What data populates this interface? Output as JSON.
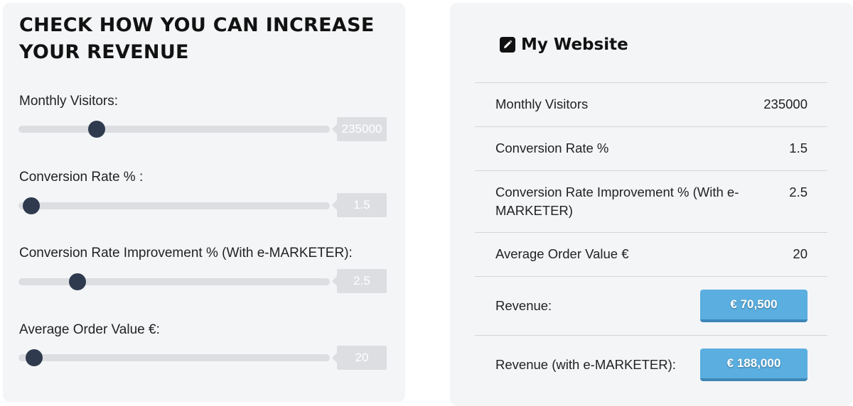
{
  "calculator": {
    "title": "CHECK HOW YOU CAN INCREASE YOUR REVENUE",
    "fields": [
      {
        "label": "Monthly Visitors:",
        "value": "235000",
        "fraction": 0.25
      },
      {
        "label": "Conversion Rate % :",
        "value": "1.5",
        "fraction": 0.04
      },
      {
        "label": "Conversion Rate Improvement % (With e-MARKETER):",
        "value": "2.5",
        "fraction": 0.19
      },
      {
        "label": "Average Order Value €:",
        "value": "20",
        "fraction": 0.05
      }
    ]
  },
  "summary": {
    "title": "My Website",
    "icon": "pencil-edit-icon",
    "rows": [
      {
        "label": "Monthly Visitors",
        "value": "235000"
      },
      {
        "label": "Conversion Rate %",
        "value": "1.5"
      },
      {
        "label": "Conversion Rate Improvement % (With e-MARKETER)",
        "value": "2.5"
      },
      {
        "label": "Average Order Value €",
        "value": "20"
      }
    ],
    "revenue_label": "Revenue:",
    "revenue_value": "€ 70,500",
    "revenue_em_label": "Revenue (with e-MARKETER):",
    "revenue_em_value": "€ 188,000"
  },
  "colors": {
    "thumb": "#2f3a4e",
    "track": "#dcdee1",
    "button": "#5aaee0",
    "panel_bg": "#f4f5f7"
  }
}
